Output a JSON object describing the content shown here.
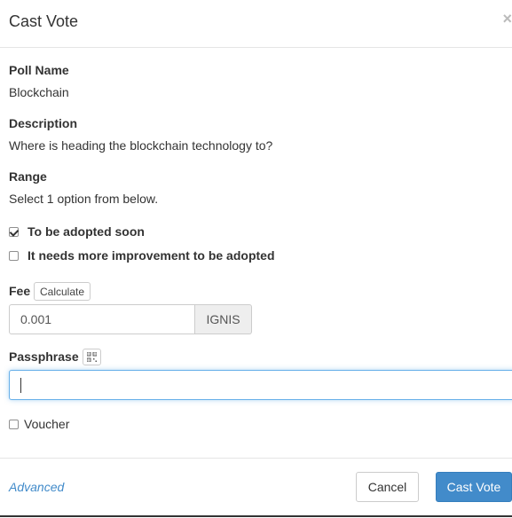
{
  "modal": {
    "title": "Cast Vote",
    "close_symbol": "×"
  },
  "poll": {
    "name_label": "Poll Name",
    "name_value": "Blockchain",
    "description_label": "Description",
    "description_value": "Where is heading the blockchain technology to?",
    "range_label": "Range",
    "range_value": "Select 1 option from below.",
    "options": [
      {
        "label": "To be adopted soon",
        "checked": true
      },
      {
        "label": "It needs more improvement to be adopted",
        "checked": false
      }
    ]
  },
  "fee": {
    "label": "Fee",
    "calculate_label": "Calculate",
    "value": "0.001",
    "currency": "IGNIS"
  },
  "passphrase": {
    "label": "Passphrase",
    "qr_icon": "qr-code-icon",
    "value": ""
  },
  "voucher": {
    "label": "Voucher",
    "checked": false
  },
  "footer": {
    "advanced_label": "Advanced",
    "cancel_label": "Cancel",
    "submit_label": "Cast Vote"
  },
  "colors": {
    "primary": "#428bca",
    "link": "#428bca",
    "focus_border": "#66afe9"
  }
}
